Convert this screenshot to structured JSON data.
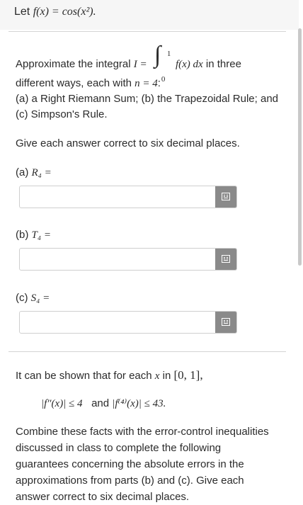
{
  "header": {
    "question_label": "Let",
    "function_def": "f(x) = cos(x²)."
  },
  "problem": {
    "intro": "Approximate the integral",
    "integral_lhs": "I =",
    "upper_limit": "1",
    "lower_limit": "0",
    "integrand": "f(x) dx",
    "intro_tail": "in three",
    "line2_a": "different ways, each with",
    "line2_n": "n = 4",
    "line2_b": ":",
    "line3": "(a) a Right Riemann Sum; (b) the Trapezoidal Rule; and",
    "line4": "(c) Simpson's Rule.",
    "precision_note": "Give each answer correct to six decimal places."
  },
  "answers": {
    "a_label": "(a)",
    "a_symbol": "R₄ =",
    "a_value": "",
    "b_label": "(b)",
    "b_symbol": "T₄ =",
    "b_value": "",
    "c_label": "(c)",
    "c_symbol": "S₄ =",
    "c_value": ""
  },
  "followup": {
    "line1_a": "It can be shown that for each",
    "line1_x": "x",
    "line1_in": "in",
    "line1_interval": "[0, 1],",
    "bound1": "|f″(x)| ≤ 4",
    "and_word": "and",
    "bound2": "|f⁽⁴⁾(x)| ≤ 43.",
    "para_lines": [
      "Combine these facts with the error-control inequalities",
      "discussed in class to complete the following",
      "guarantees concerning the absolute errors in the",
      "approximations from parts (b) and (c). Give each",
      "answer correct to six decimal places."
    ]
  },
  "icons": {
    "keyboard_button": "keyboard-icon"
  },
  "colors": {
    "header_bg": "#f6f6f6",
    "button_gray": "#8a8a8a",
    "text": "#2b2b2b"
  }
}
